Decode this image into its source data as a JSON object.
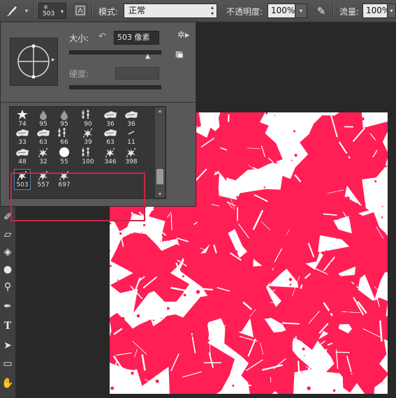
{
  "options_bar": {
    "brush_size": "503",
    "mode_label": "模式:",
    "mode_value": "正常",
    "opacity_label": "不透明度:",
    "opacity_value": "100%",
    "flow_label": "流量:",
    "flow_value": "100%"
  },
  "brush_panel": {
    "size_label": "大小:",
    "size_value": "503 像素",
    "hardness_label": "硬度:",
    "size_slider_fraction": 0.88
  },
  "brushes": [
    {
      "label": "74",
      "shape": "star"
    },
    {
      "label": "95",
      "shape": "drop"
    },
    {
      "label": "95",
      "shape": "drop"
    },
    {
      "label": "90",
      "shape": "texture"
    },
    {
      "label": "36",
      "shape": "cloud"
    },
    {
      "label": "36",
      "shape": "cloud"
    },
    {
      "label": "33",
      "shape": "cloud"
    },
    {
      "label": "63",
      "shape": "cloud"
    },
    {
      "label": "66",
      "shape": "texture"
    },
    {
      "label": "39",
      "shape": "splat"
    },
    {
      "label": "63",
      "shape": "cloud"
    },
    {
      "label": "11",
      "shape": "dash"
    },
    {
      "label": "48",
      "shape": "cloud"
    },
    {
      "label": "32",
      "shape": "splat"
    },
    {
      "label": "55",
      "shape": "circle"
    },
    {
      "label": "100",
      "shape": "texture"
    },
    {
      "label": "346",
      "shape": "splat"
    },
    {
      "label": "398",
      "shape": "splat"
    },
    {
      "label": "503",
      "shape": "splat"
    },
    {
      "label": "557",
      "shape": "splat"
    },
    {
      "label": "697",
      "shape": "splat"
    }
  ],
  "selected_brush_index": 18,
  "colors": {
    "paint": "#ff1f55",
    "highlight": "#c8264a"
  }
}
